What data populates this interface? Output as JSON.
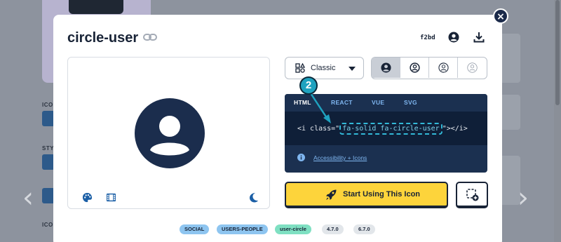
{
  "icon": {
    "title": "circle-user",
    "unicode": "f2bd"
  },
  "style_select": {
    "value": "Classic"
  },
  "code": {
    "tabs": [
      "HTML",
      "REACT",
      "VUE",
      "SVG"
    ],
    "active_tab": "HTML",
    "prefix": "<i class=\"",
    "classes": "fa-solid fa-circle-user",
    "suffix": "\"></i>",
    "accessibility_link": "Accessibility + Icons"
  },
  "callout": {
    "number": "2"
  },
  "actions": {
    "start_label": "Start Using This Icon"
  },
  "tags": {
    "categories": [
      "SOCIAL",
      "USERS-PEOPLE"
    ],
    "name": "user-circle",
    "versions": [
      "4.7.0",
      "6.7.0"
    ]
  },
  "background": {
    "labels": [
      "ICO",
      "STY",
      "ICO"
    ]
  },
  "colors": {
    "accent": "#1b3050",
    "button_yellow": "#fdd43b",
    "callout": "#1fa2bf",
    "tag_category": "#8ec5f0",
    "tag_name": "#7fe0c2"
  },
  "icons": [
    "link-icon",
    "user-icon",
    "download-icon",
    "palette-icon",
    "film-icon",
    "moon-icon",
    "shapes-icon",
    "info-icon",
    "rocket-icon",
    "add-to-collection-icon",
    "close-icon"
  ]
}
